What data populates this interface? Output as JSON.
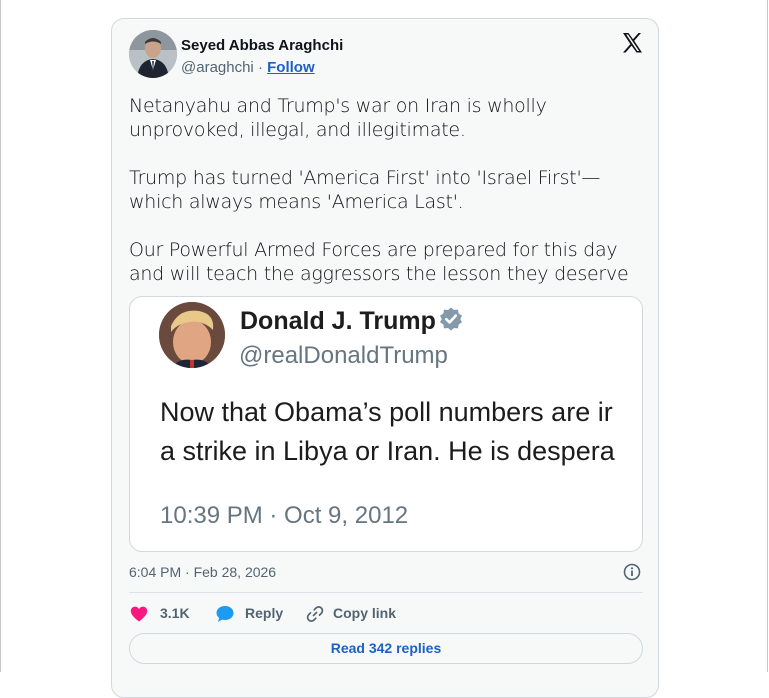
{
  "author": {
    "name": "Seyed Abbas Araghchi",
    "handle": "@araghchi",
    "separator": "·",
    "follow_label": "Follow"
  },
  "tweet": {
    "paragraphs": [
      "Netanyahu and Trump's war on Iran is wholly unprovoked, illegal, and illegitimate.",
      "Trump has turned 'America First' into 'Israel First'—which always means 'America Last'.",
      "Our Powerful Armed Forces are prepared for this day and will teach the aggressors the lesson they deserve"
    ],
    "timestamp": "6:04 PM · Feb 28, 2026"
  },
  "embedded_post": {
    "name": "Donald J. Trump",
    "handle": "@realDonaldTrump",
    "text_line1": "Now that Obama’s poll numbers are ir",
    "text_line2": "a strike in Libya or Iran.  He is despera",
    "date": "10:39 PM · Oct 9, 2012"
  },
  "actions": {
    "likes": "3.1K",
    "reply_label": "Reply",
    "copy_link_label": "Copy link"
  },
  "read_replies_label": "Read 342 replies",
  "icons": [
    "x-logo-icon",
    "verified-badge-icon",
    "info-icon",
    "heart-icon",
    "reply-bubble-icon",
    "link-icon"
  ],
  "colors": {
    "link_blue": "#1d5fc4",
    "heart_pink": "#f91880",
    "reply_blue": "#1d9bf0",
    "card_bg": "#f7f9f9"
  }
}
